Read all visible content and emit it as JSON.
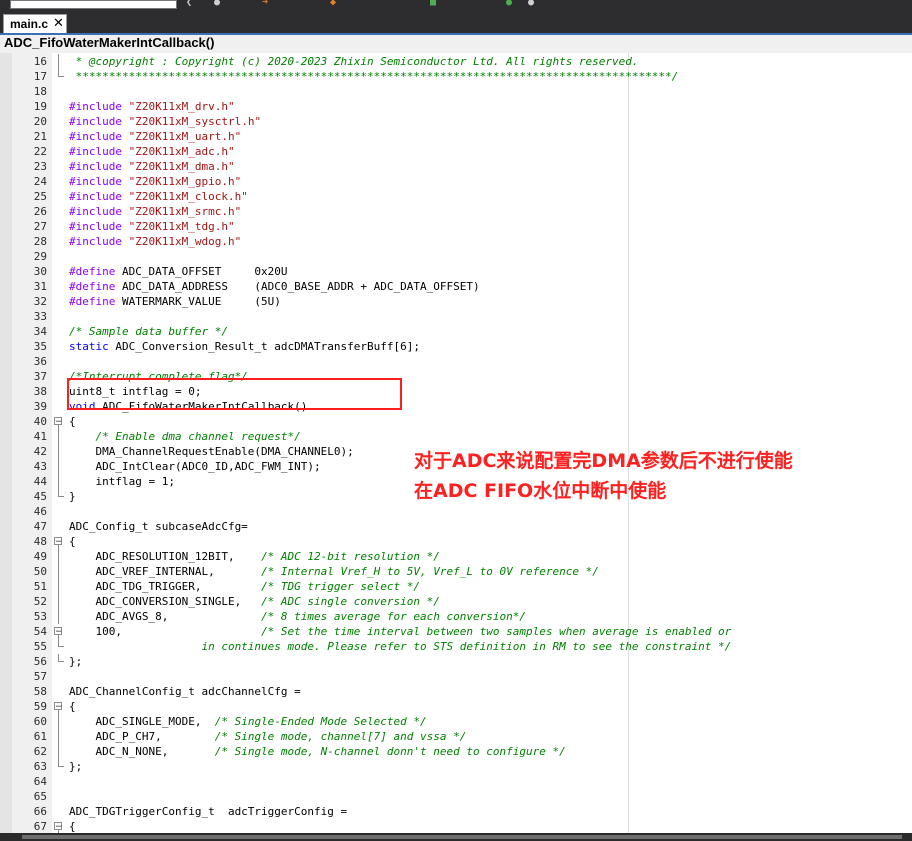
{
  "toolbar": {
    "icons": [
      "back-icon",
      "forward-icon",
      "bookmark-icon",
      "find-icon",
      "build-icon",
      "debug-icon",
      "settings-icon"
    ]
  },
  "tab": {
    "label": "main.c",
    "close": "✕"
  },
  "funcbar": {
    "label": "ADC_FifoWaterMakerIntCallback()"
  },
  "annotation": {
    "line1": "对于ADC来说配置完DMA参数后不进行使能",
    "line2": "在ADC FIFO水位中断中使能"
  },
  "lines": [
    {
      "n": "16",
      "fold": "v",
      "segs": [
        [
          "cm",
          " * @copyright : Copyright (c) 2020-2023 Zhixin Semiconductor Ltd. All rights reserved."
        ]
      ]
    },
    {
      "n": "17",
      "fold": "e",
      "segs": [
        [
          "cm",
          " ******************************************************************************************/"
        ]
      ]
    },
    {
      "n": "18",
      "segs": []
    },
    {
      "n": "19",
      "segs": [
        [
          "pp",
          "#include "
        ],
        [
          "str",
          "\"Z20K11xM_drv.h\""
        ]
      ]
    },
    {
      "n": "20",
      "segs": [
        [
          "pp",
          "#include "
        ],
        [
          "str",
          "\"Z20K11xM_sysctrl.h\""
        ]
      ]
    },
    {
      "n": "21",
      "segs": [
        [
          "pp",
          "#include "
        ],
        [
          "str",
          "\"Z20K11xM_uart.h\""
        ]
      ]
    },
    {
      "n": "22",
      "segs": [
        [
          "pp",
          "#include "
        ],
        [
          "str",
          "\"Z20K11xM_adc.h\""
        ]
      ]
    },
    {
      "n": "23",
      "segs": [
        [
          "pp",
          "#include "
        ],
        [
          "str",
          "\"Z20K11xM_dma.h\""
        ]
      ]
    },
    {
      "n": "24",
      "segs": [
        [
          "pp",
          "#include "
        ],
        [
          "str",
          "\"Z20K11xM_gpio.h\""
        ]
      ]
    },
    {
      "n": "25",
      "segs": [
        [
          "pp",
          "#include "
        ],
        [
          "str",
          "\"Z20K11xM_clock.h\""
        ]
      ]
    },
    {
      "n": "26",
      "segs": [
        [
          "pp",
          "#include "
        ],
        [
          "str",
          "\"Z20K11xM_srmc.h\""
        ]
      ]
    },
    {
      "n": "27",
      "segs": [
        [
          "pp",
          "#include "
        ],
        [
          "str",
          "\"Z20K11xM_tdg.h\""
        ]
      ]
    },
    {
      "n": "28",
      "segs": [
        [
          "pp",
          "#include "
        ],
        [
          "str",
          "\"Z20K11xM_wdog.h\""
        ]
      ]
    },
    {
      "n": "29",
      "segs": []
    },
    {
      "n": "30",
      "segs": [
        [
          "pp",
          "#define "
        ],
        [
          "",
          "ADC_DATA_OFFSET     0x20U"
        ]
      ]
    },
    {
      "n": "31",
      "segs": [
        [
          "pp",
          "#define "
        ],
        [
          "",
          "ADC_DATA_ADDRESS    (ADC0_BASE_ADDR + ADC_DATA_OFFSET)"
        ]
      ]
    },
    {
      "n": "32",
      "segs": [
        [
          "pp",
          "#define "
        ],
        [
          "",
          "WATERMARK_VALUE     (5U)"
        ]
      ]
    },
    {
      "n": "33",
      "segs": []
    },
    {
      "n": "34",
      "segs": [
        [
          "cm",
          "/* Sample data buffer */"
        ]
      ]
    },
    {
      "n": "35",
      "segs": [
        [
          "kw",
          "static "
        ],
        [
          "",
          "ADC_Conversion_Result_t adcDMATransferBuff[6];"
        ]
      ]
    },
    {
      "n": "36",
      "segs": []
    },
    {
      "n": "37",
      "segs": [
        [
          "cm",
          "/*Interrupt complete flag*/"
        ]
      ]
    },
    {
      "n": "38",
      "segs": [
        [
          "",
          "uint8_t intflag = 0;"
        ]
      ]
    },
    {
      "n": "39",
      "segs": [
        [
          "kw",
          "void "
        ],
        [
          "",
          "ADC_FifoWaterMakerIntCallback()"
        ]
      ]
    },
    {
      "n": "40",
      "fold": "box",
      "segs": [
        [
          "",
          "{"
        ]
      ]
    },
    {
      "n": "41",
      "fold": "v",
      "segs": [
        [
          "cm",
          "    /* Enable dma channel request*/"
        ]
      ]
    },
    {
      "n": "42",
      "fold": "v",
      "segs": [
        [
          "",
          "    DMA_ChannelRequestEnable(DMA_CHANNEL0);"
        ]
      ]
    },
    {
      "n": "43",
      "fold": "v",
      "segs": [
        [
          "",
          "    ADC_IntClear(ADC0_ID,ADC_FWM_INT);"
        ]
      ]
    },
    {
      "n": "44",
      "fold": "v",
      "segs": [
        [
          "",
          "    intflag = 1;"
        ]
      ]
    },
    {
      "n": "45",
      "fold": "e",
      "segs": [
        [
          "",
          "}"
        ]
      ]
    },
    {
      "n": "46",
      "segs": []
    },
    {
      "n": "47",
      "segs": [
        [
          "",
          "ADC_Config_t subcaseAdcCfg="
        ]
      ]
    },
    {
      "n": "48",
      "fold": "box",
      "segs": [
        [
          "",
          "{"
        ]
      ]
    },
    {
      "n": "49",
      "fold": "v",
      "segs": [
        [
          "",
          "    ADC_RESOLUTION_12BIT,    "
        ],
        [
          "cm",
          "/* ADC 12-bit resolution */"
        ]
      ]
    },
    {
      "n": "50",
      "fold": "v",
      "segs": [
        [
          "",
          "    ADC_VREF_INTERNAL,       "
        ],
        [
          "cm",
          "/* Internal Vref_H to 5V, Vref_L to 0V reference */"
        ]
      ]
    },
    {
      "n": "51",
      "fold": "v",
      "segs": [
        [
          "",
          "    ADC_TDG_TRIGGER,         "
        ],
        [
          "cm",
          "/* TDG trigger select */"
        ]
      ]
    },
    {
      "n": "52",
      "fold": "v",
      "segs": [
        [
          "",
          "    ADC_CONVERSION_SINGLE,   "
        ],
        [
          "cm",
          "/* ADC single conversion */"
        ]
      ]
    },
    {
      "n": "53",
      "fold": "v",
      "segs": [
        [
          "",
          "    ADC_AVGS_8,              "
        ],
        [
          "cm",
          "/* 8 times average for each conversion*/"
        ]
      ]
    },
    {
      "n": "54",
      "fold": "box",
      "segs": [
        [
          "",
          "    100,                     "
        ],
        [
          "cm",
          "/* Set the time interval between two samples when average is enabled or"
        ]
      ]
    },
    {
      "n": "55",
      "fold": "e",
      "segs": [
        [
          "cm",
          "                    in continues mode. Please refer to STS definition in RM to see the constraint */"
        ]
      ]
    },
    {
      "n": "56",
      "fold": "e",
      "segs": [
        [
          "",
          "};"
        ]
      ]
    },
    {
      "n": "57",
      "segs": []
    },
    {
      "n": "58",
      "segs": [
        [
          "",
          "ADC_ChannelConfig_t adcChannelCfg ="
        ]
      ]
    },
    {
      "n": "59",
      "fold": "box",
      "segs": [
        [
          "",
          "{"
        ]
      ]
    },
    {
      "n": "60",
      "fold": "v",
      "segs": [
        [
          "",
          "    ADC_SINGLE_MODE,  "
        ],
        [
          "cm",
          "/* Single-Ended Mode Selected */"
        ]
      ]
    },
    {
      "n": "61",
      "fold": "v",
      "segs": [
        [
          "",
          "    ADC_P_CH7,        "
        ],
        [
          "cm",
          "/* Single mode, channel[7] and vssa */"
        ]
      ]
    },
    {
      "n": "62",
      "fold": "v",
      "segs": [
        [
          "",
          "    ADC_N_NONE,       "
        ],
        [
          "cm",
          "/* Single mode, N-channel donn't need to configure */"
        ]
      ]
    },
    {
      "n": "63",
      "fold": "e",
      "segs": [
        [
          "",
          "};"
        ]
      ]
    },
    {
      "n": "64",
      "segs": []
    },
    {
      "n": "65",
      "segs": []
    },
    {
      "n": "66",
      "segs": [
        [
          "",
          "ADC_TDGTriggerConfig_t  adcTriggerConfig ="
        ]
      ]
    },
    {
      "n": "67",
      "fold": "box",
      "segs": [
        [
          "",
          "{"
        ]
      ]
    }
  ]
}
